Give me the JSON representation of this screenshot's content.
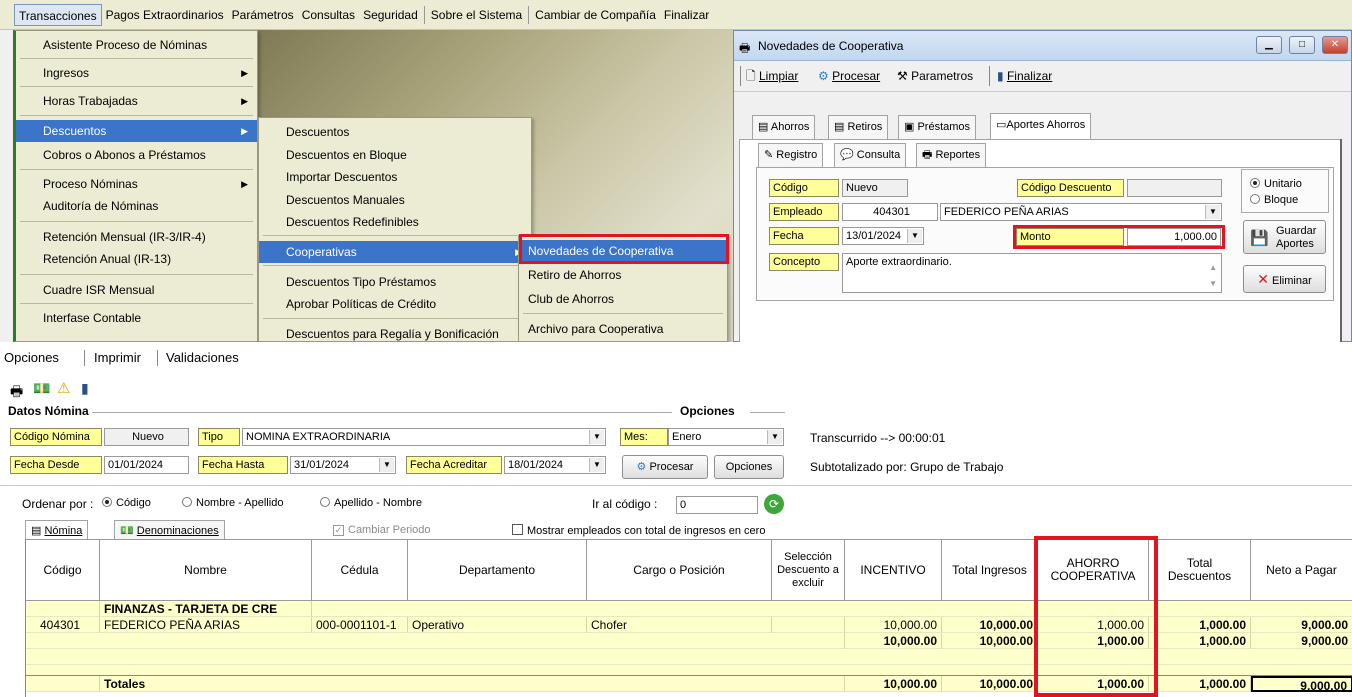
{
  "top_menu": [
    "Transacciones",
    "Pagos Extraordinarios",
    "Parámetros",
    "Consultas",
    "Seguridad",
    "Sobre el Sistema",
    "Cambiar de Compañía",
    "Finalizar"
  ],
  "menu1": [
    "Asistente Proceso de Nóminas",
    "Ingresos",
    "Horas Trabajadas",
    "Descuentos",
    "Cobros o Abonos a Préstamos",
    "Proceso Nóminas",
    "Auditoría de Nóminas",
    "Retención Mensual  (IR-3/IR-4)",
    "Retención Anual  (IR-13)",
    "Cuadre ISR Mensual",
    "Interfase Contable"
  ],
  "menu2": [
    "Descuentos",
    "Descuentos en Bloque",
    "Importar Descuentos",
    "Descuentos Manuales",
    "Descuentos Redefinibles",
    "Cooperativas",
    "Descuentos Tipo Préstamos",
    "Aprobar Políticas de Crédito",
    "Descuentos  para Regalía y Bonificación"
  ],
  "menu3": [
    "Novedades de Cooperativa",
    "Retiro de Ahorros",
    "Club de Ahorros",
    "Archivo para Cooperativa"
  ],
  "dialog": {
    "title": "Novedades de Cooperativa",
    "toolbar": {
      "limpiar": "Limpiar",
      "procesar": "Procesar",
      "parametros": "Parametros",
      "finalizar": "Finalizar"
    },
    "tabs": [
      "Ahorros",
      "Retiros",
      "Préstamos",
      "Aportes Ahorros"
    ],
    "subtabs": [
      "Registro",
      "Consulta",
      "Reportes"
    ],
    "codigo_label": "Código",
    "codigo_value": "Nuevo",
    "codigo_desc_label": "Código Descuento",
    "codigo_desc_value": "",
    "empleado_label": "Empleado",
    "empleado_id": "404301",
    "empleado_name": "FEDERICO PEÑA ARIAS",
    "fecha_label": "Fecha",
    "fecha_value": "13/01/2024",
    "monto_label": "Monto",
    "monto_value": "1,000.00",
    "concepto_label": "Concepto",
    "concepto_value": "Aporte extraordinario.",
    "radio_unitario": "Unitario",
    "radio_bloque": "Bloque",
    "guardar_label1": "Guardar",
    "guardar_label2": "Aportes",
    "eliminar_label": "Eliminar"
  },
  "lower": {
    "menu": [
      "Opciones",
      "Imprimir",
      "Validaciones"
    ],
    "datos_nomina": "Datos Nómina",
    "opciones": "Opciones",
    "codigo_nomina_label": "Código Nómina",
    "codigo_nomina_value": "Nuevo",
    "tipo_label": "Tipo",
    "tipo_value": "NOMINA EXTRAORDINARIA",
    "mes_label": "Mes:",
    "mes_value": "Enero",
    "transcurrido": "Transcurrido --> 00:00:01",
    "fecha_desde_label": "Fecha Desde",
    "fecha_desde_value": "01/01/2024",
    "fecha_hasta_label": "Fecha Hasta",
    "fecha_hasta_value": "31/01/2024",
    "fecha_acreditar_label": "Fecha Acreditar",
    "fecha_acreditar_value": "18/01/2024",
    "procesar_btn": "Procesar",
    "opciones_btn": "Opciones",
    "subtotalizado": "Subtotalizado por: Grupo de Trabajo",
    "ordenar_por": "Ordenar por :",
    "ord_codigo": "Código",
    "ord_nombre": "Nombre - Apellido",
    "ord_apellido": "Apellido - Nombre",
    "ir_al_codigo": "Ir al código :",
    "ir_al_codigo_value": "0",
    "tab_nomina": "Nómina",
    "tab_denominaciones": "Denominaciones",
    "cambiar_periodo": "Cambiar Periodo",
    "mostrar_empleados": "Mostrar empleados con total de ingresos en cero"
  },
  "grid": {
    "headers": [
      "Código",
      "Nombre",
      "Cédula",
      "Departamento",
      "Cargo o Posición",
      "Selección Descuento a excluir",
      "INCENTIVO",
      "Total Ingresos",
      "AHORRO COOPERATIVA",
      "Total Descuentos",
      "Neto a Pagar"
    ],
    "group": "FINANZAS - TARJETA DE CRE",
    "row": {
      "codigo": "404301",
      "nombre": "FEDERICO PEÑA ARIAS",
      "cedula": "000-0001101-1",
      "departamento": "Operativo",
      "cargo": "Chofer",
      "incentivo": "10,000.00",
      "total_ingresos": "10,000.00",
      "ahorro": "1,000.00",
      "total_desc": "1,000.00",
      "neto": "9,000.00"
    },
    "subtotal": {
      "incentivo": "10,000.00",
      "total_ingresos": "10,000.00",
      "ahorro": "1,000.00",
      "total_desc": "1,000.00",
      "neto": "9,000.00"
    },
    "totales_label": "Totales",
    "totales": {
      "incentivo": "10,000.00",
      "total_ingresos": "10,000.00",
      "ahorro": "1,000.00",
      "total_desc": "1,000.00",
      "neto": "9,000.00"
    }
  },
  "colors": {
    "highlight": "#3b74c9",
    "redbox": "#e3141f",
    "field_label": "#ffff99"
  }
}
